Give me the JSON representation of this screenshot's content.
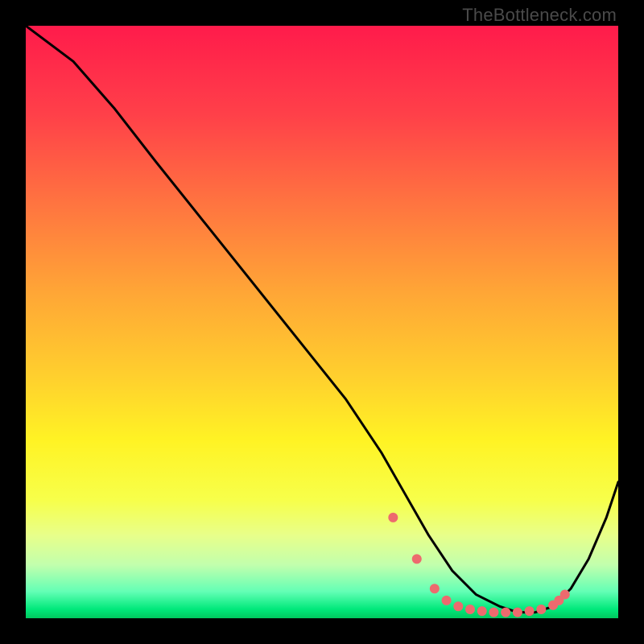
{
  "watermark": "TheBottleneck.com",
  "chart_data": {
    "type": "line",
    "title": "",
    "xlabel": "",
    "ylabel": "",
    "xlim": [
      0,
      100
    ],
    "ylim": [
      0,
      100
    ],
    "grid": false,
    "legend": false,
    "gradient_stops": [
      {
        "pos": 0.0,
        "color": "#ff1b4b"
      },
      {
        "pos": 0.15,
        "color": "#ff4049"
      },
      {
        "pos": 0.3,
        "color": "#ff7440"
      },
      {
        "pos": 0.45,
        "color": "#ffa636"
      },
      {
        "pos": 0.6,
        "color": "#ffd22d"
      },
      {
        "pos": 0.7,
        "color": "#fff324"
      },
      {
        "pos": 0.8,
        "color": "#f7ff4a"
      },
      {
        "pos": 0.86,
        "color": "#e8ff8a"
      },
      {
        "pos": 0.91,
        "color": "#c2ffad"
      },
      {
        "pos": 0.955,
        "color": "#63ffb5"
      },
      {
        "pos": 0.985,
        "color": "#00e87a"
      },
      {
        "pos": 1.0,
        "color": "#00c85e"
      }
    ],
    "series": [
      {
        "name": "bottleneck-curve",
        "x": [
          0,
          8,
          15,
          22,
          30,
          38,
          46,
          54,
          60,
          64,
          68,
          72,
          76,
          80,
          83,
          86,
          89,
          92,
          95,
          98,
          100
        ],
        "y": [
          100,
          94,
          86,
          77,
          67,
          57,
          47,
          37,
          28,
          21,
          14,
          8,
          4,
          2,
          1,
          1,
          2,
          5,
          10,
          17,
          23
        ]
      }
    ],
    "markers": {
      "name": "highlighted-points",
      "color": "#ed6a6e",
      "x": [
        62,
        66,
        69,
        71,
        73,
        75,
        77,
        79,
        81,
        83,
        85,
        87,
        89,
        90,
        91
      ],
      "y": [
        17,
        10,
        5,
        3,
        2,
        1.5,
        1.2,
        1,
        1,
        1,
        1.2,
        1.5,
        2.2,
        3,
        4
      ]
    }
  }
}
